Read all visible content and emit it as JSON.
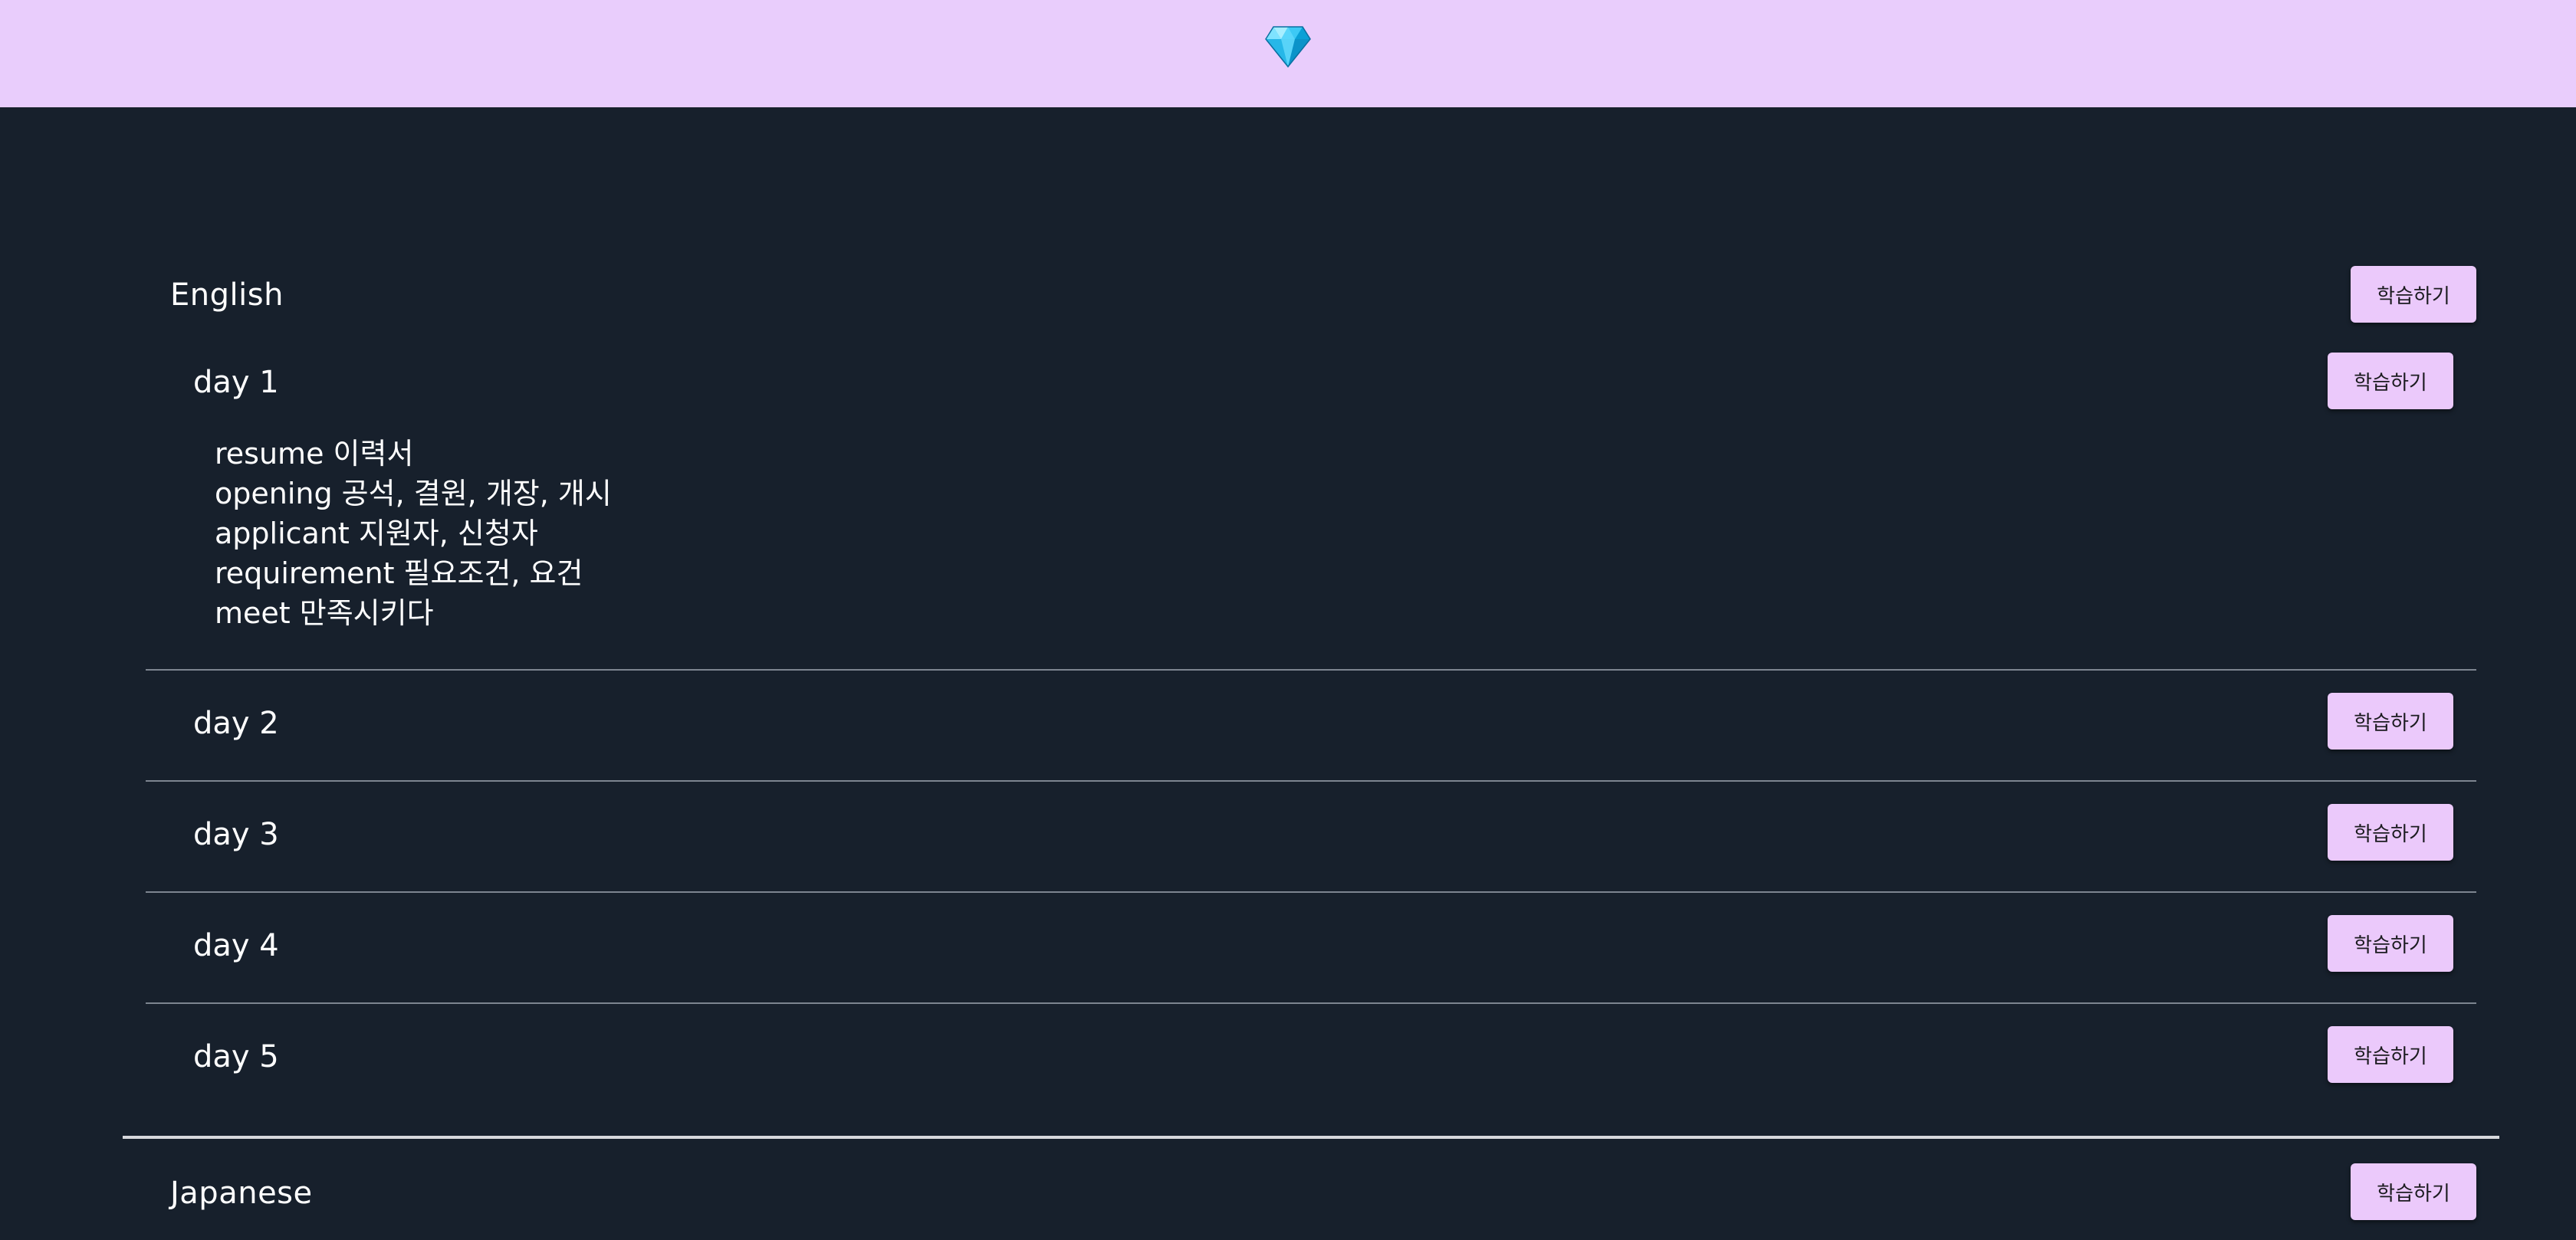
{
  "header": {
    "logo_icon": "gem-icon"
  },
  "colors": {
    "header_bg": "#e9cdfc",
    "page_bg": "#17202c",
    "button_bg": "#ebc9fb"
  },
  "sections": [
    {
      "title": "English",
      "study_label": "학습하기",
      "days": [
        {
          "title": "day 1",
          "study_label": "학습하기",
          "expanded": true,
          "words": [
            "resume 이력서",
            "opening 공석, 결원, 개장, 개시",
            "applicant 지원자, 신청자",
            "requirement 필요조건, 요건",
            "meet 만족시키다"
          ]
        },
        {
          "title": "day 2",
          "study_label": "학습하기"
        },
        {
          "title": "day 3",
          "study_label": "학습하기"
        },
        {
          "title": "day 4",
          "study_label": "학습하기"
        },
        {
          "title": "day 5",
          "study_label": "학습하기"
        }
      ]
    },
    {
      "title": "Japanese",
      "study_label": "학습하기"
    }
  ]
}
